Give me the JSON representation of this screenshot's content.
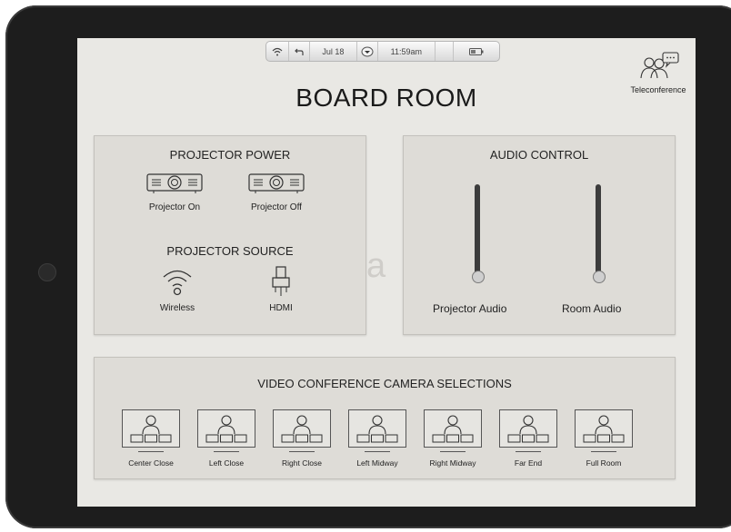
{
  "status_bar": {
    "date": "Jul 18",
    "time": "11:59am"
  },
  "header": {
    "title": "BOARD ROOM",
    "teleconference_label": "Teleconference"
  },
  "projector_power": {
    "title": "PROJECTOR POWER",
    "on_label": "Projector On",
    "off_label": "Projector Off"
  },
  "projector_source": {
    "title": "PROJECTOR SOURCE",
    "wireless_label": "Wireless",
    "hdmi_label": "HDMI"
  },
  "audio_control": {
    "title": "AUDIO CONTROL",
    "projector_audio_label": "Projector Audio",
    "room_audio_label": "Room Audio",
    "projector_audio_level": 0.05,
    "room_audio_level": 0.05
  },
  "video_conference": {
    "title": "VIDEO CONFERENCE CAMERA SELECTIONS",
    "presets": [
      {
        "label": "Center Close"
      },
      {
        "label": "Left Close"
      },
      {
        "label": "Right Close"
      },
      {
        "label": "Left Midway"
      },
      {
        "label": "Right Midway"
      },
      {
        "label": "Far End"
      },
      {
        "label": "Full Room"
      }
    ]
  },
  "icons": {
    "status": [
      "wifi-icon",
      "back-icon",
      "dropdown-icon",
      "battery-icon"
    ],
    "teleconference": "people-chat-icon",
    "projector": "projector-icon",
    "wireless": "wifi-icon",
    "hdmi": "hdmi-icon",
    "camera_preset": "person-with-seats-icon"
  },
  "colors": {
    "screen_background": "#e9e8e4",
    "panel_background": "#dedcd7",
    "slider_track": "#3c3c3c",
    "tablet_bezel": "#1d1d1d"
  }
}
